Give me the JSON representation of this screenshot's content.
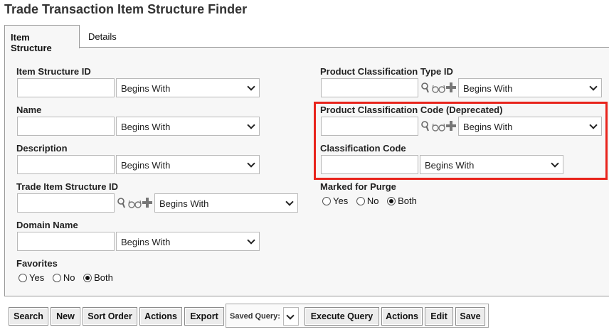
{
  "page": {
    "title": "Trade Transaction Item Structure Finder"
  },
  "tabs": [
    {
      "label": "Item Structure",
      "active": true
    },
    {
      "label": "Details",
      "active": false
    }
  ],
  "operator_default": "Begins With",
  "fields": {
    "item_structure_id": {
      "label": "Item Structure ID",
      "value": "",
      "operator": "Begins With"
    },
    "name": {
      "label": "Name",
      "value": "",
      "operator": "Begins With"
    },
    "description": {
      "label": "Description",
      "value": "",
      "operator": "Begins With"
    },
    "trade_item_structure_id": {
      "label": "Trade Item Structure ID",
      "value": "",
      "operator": "Begins With"
    },
    "domain_name": {
      "label": "Domain Name",
      "value": "",
      "operator": "Begins With"
    },
    "favorites": {
      "label": "Favorites",
      "options": [
        "Yes",
        "No",
        "Both"
      ],
      "selected": "Both"
    },
    "product_classification_type_id": {
      "label": "Product Classification Type ID",
      "value": "",
      "operator": "Begins With"
    },
    "product_classification_code": {
      "label": "Product Classification Code (Deprecated)",
      "value": "",
      "operator": "Begins With"
    },
    "classification_code": {
      "label": "Classification Code",
      "value": "",
      "operator": "Begins With"
    },
    "marked_for_purge": {
      "label": "Marked for Purge",
      "options": [
        "Yes",
        "No",
        "Both"
      ],
      "selected": "Both"
    }
  },
  "buttons": {
    "search": "Search",
    "new": "New",
    "sort_order": "Sort Order",
    "actions": "Actions",
    "export": "Export",
    "saved_query_label": "Saved Query:",
    "execute_query": "Execute Query",
    "actions2": "Actions",
    "edit": "Edit",
    "save": "Save"
  },
  "icons": [
    "search-icon",
    "view-glasses-icon",
    "add-icon"
  ],
  "colors": {
    "highlight": "#e8241c",
    "panel": "#f7f7f7"
  }
}
